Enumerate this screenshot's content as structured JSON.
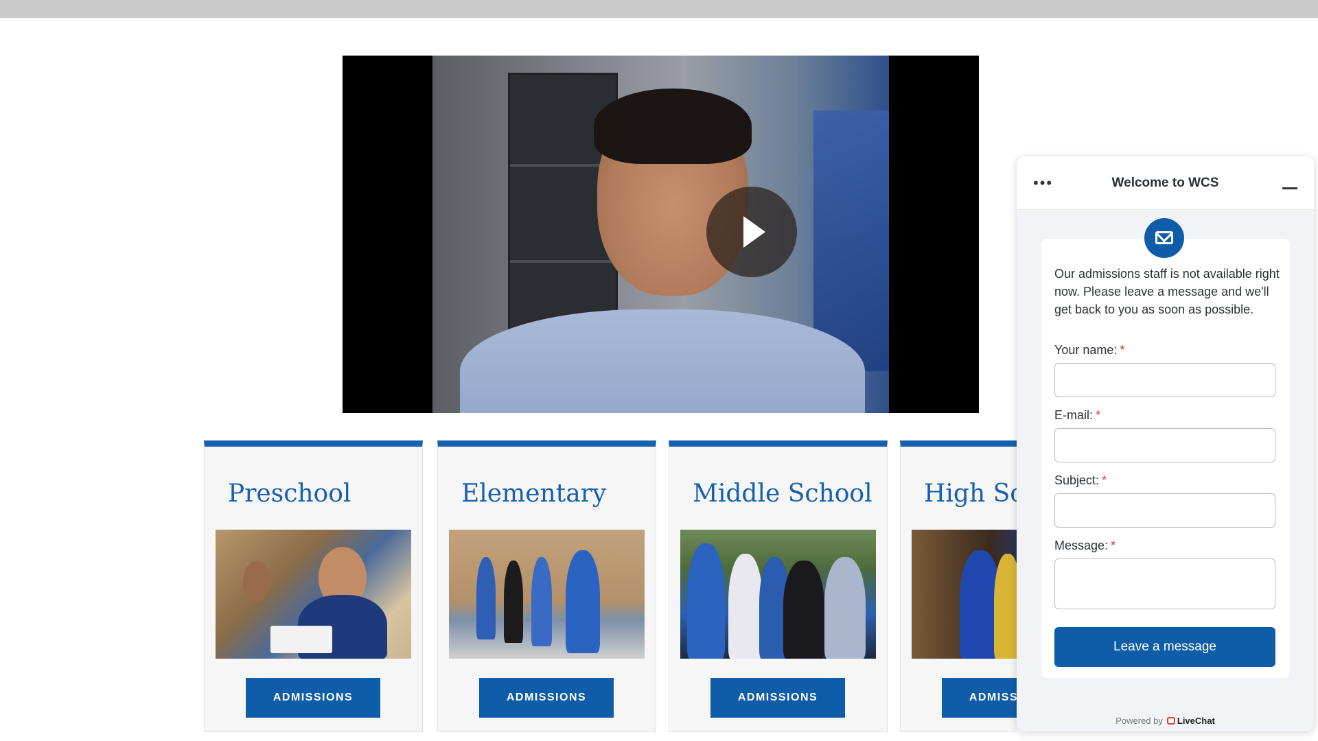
{
  "video": {
    "play_label": "play-icon"
  },
  "cards": [
    {
      "title": "Preschool",
      "button": "ADMISSIONS"
    },
    {
      "title": "Elementary",
      "button": "ADMISSIONS"
    },
    {
      "title": "Middle School",
      "button": "ADMISSIONS"
    },
    {
      "title": "High School",
      "button": "ADMISSIONS"
    }
  ],
  "chat": {
    "title": "Welcome to WCS",
    "menu_icon": "more-dots-icon",
    "minimize_icon": "minimize-icon",
    "badge_icon": "mail-icon",
    "notice": "Our admissions staff is not available right now. Please leave a message and we'll get back to you as soon as possible.",
    "fields": {
      "name_label": "Your name:",
      "email_label": "E-mail:",
      "subject_label": "Subject:",
      "message_label": "Message:",
      "required_mark": "*"
    },
    "submit": "Leave a message",
    "powered_prefix": "Powered by",
    "powered_brand": "LiveChat"
  },
  "colors": {
    "brand_blue": "#0f5ca8",
    "required_red": "#d0352b"
  }
}
